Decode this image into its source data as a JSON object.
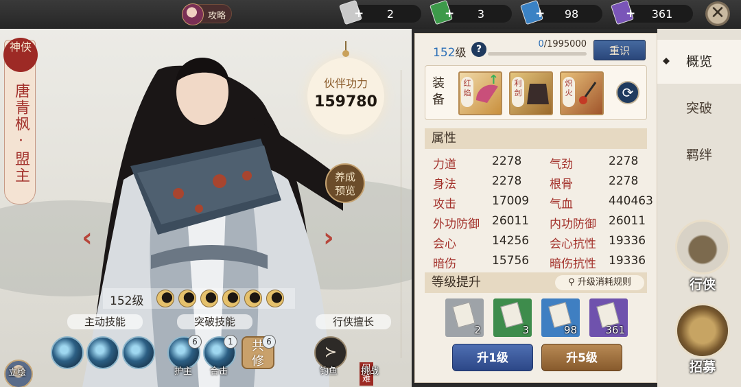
{
  "topbar": {
    "guide_label": "攻略",
    "resources": [
      {
        "icon": "scroll-grey-icon",
        "value": "2",
        "color": "#c9c9c9"
      },
      {
        "icon": "scroll-green-icon",
        "value": "3",
        "color": "#3d9a4a"
      },
      {
        "icon": "scroll-blue-icon",
        "value": "98",
        "color": "#3b82c4"
      },
      {
        "icon": "scroll-purple-icon",
        "value": "361",
        "color": "#7a55b8"
      }
    ],
    "close_icon": "✕"
  },
  "hero": {
    "seal": "神侠",
    "name": "唐青枫·盟主",
    "power_label": "伙伴功力",
    "power_value": "159780",
    "nurture_label": "养成预览",
    "level": "152级",
    "stars": 6
  },
  "skills": {
    "active_title": "主动技能",
    "breakthrough_title": "突破技能",
    "roam_title": "行侠擅长",
    "breakthrough": [
      {
        "label": "护主",
        "count": "6"
      },
      {
        "label": "合击",
        "count": "1"
      }
    ],
    "gongxiu": {
      "label": "共修",
      "count": "6"
    },
    "fishing_label": "钓鱼",
    "challenge_label": "挑战",
    "hard_tag": "困难",
    "lihui_label": "立绘"
  },
  "panel": {
    "level_num": "152",
    "level_unit": "级",
    "exp_current": "0",
    "exp_total": "/1995000",
    "exp_fraction": 0,
    "reknow_label": "重识",
    "equip_label": "装备",
    "equipment": [
      {
        "tag": "红焰",
        "icon": "fan-icon"
      },
      {
        "tag": "利剑",
        "icon": "armor-icon"
      },
      {
        "tag": "炽火",
        "icon": "pendant-icon"
      }
    ],
    "attr_title": "属性",
    "attributes": [
      {
        "k": "力道",
        "v": "2278"
      },
      {
        "k": "气劲",
        "v": "2278"
      },
      {
        "k": "身法",
        "v": "2278"
      },
      {
        "k": "根骨",
        "v": "2278"
      },
      {
        "k": "攻击",
        "v": "17009"
      },
      {
        "k": "气血",
        "v": "440463"
      },
      {
        "k": "外功防御",
        "v": "26011"
      },
      {
        "k": "内功防御",
        "v": "26011"
      },
      {
        "k": "会心",
        "v": "14256"
      },
      {
        "k": "会心抗性",
        "v": "19336"
      },
      {
        "k": "暗伤",
        "v": "15756"
      },
      {
        "k": "暗伤抗性",
        "v": "19336"
      }
    ],
    "upgrade_title": "等级提升",
    "rule_label": "升级消耗规则",
    "books": [
      {
        "count": "2",
        "color": "#9ea3a8"
      },
      {
        "count": "3",
        "color": "#3e8c4c"
      },
      {
        "count": "98",
        "color": "#3f7fc2"
      },
      {
        "count": "361",
        "color": "#6f52ad"
      }
    ],
    "up1_label": "升1级",
    "up5_label": "升5级"
  },
  "side": {
    "tabs": [
      "概览",
      "突破",
      "羁绊"
    ],
    "roam_label": "行侠",
    "recruit_label": "招募"
  }
}
